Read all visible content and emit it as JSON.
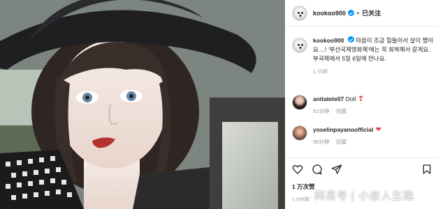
{
  "post": {
    "username": "kookoo900",
    "dot": "•",
    "follow_state": "已关注",
    "caption_user": "kookoo900",
    "caption_text": "마음이 조금 힘들어서 살이 쪘어요....! '부산국제영화제'에는 꼭 회복해서 갈게요. 부국제에서 5일 6일에 만나요.",
    "caption_time": "1 小时",
    "likes": "1 万次赞",
    "post_time": "1 小时前"
  },
  "comments": [
    {
      "username": "anitatete07",
      "text": "Doll",
      "emoji": "❣",
      "time": "51分钟",
      "reply": "回复"
    },
    {
      "username": "yoselinpayanoofficial",
      "text": "",
      "emoji": "❤",
      "time": "36分钟",
      "reply": "回复"
    }
  ],
  "watermark": "网易号 | 小彦人生路",
  "icons": [
    "verified-badge-icon",
    "heart-icon",
    "comment-icon",
    "share-icon",
    "bookmark-icon"
  ],
  "colors": {
    "verified": "#0095f6",
    "heart": "#ed4956",
    "muted": "#8e8e8e"
  }
}
